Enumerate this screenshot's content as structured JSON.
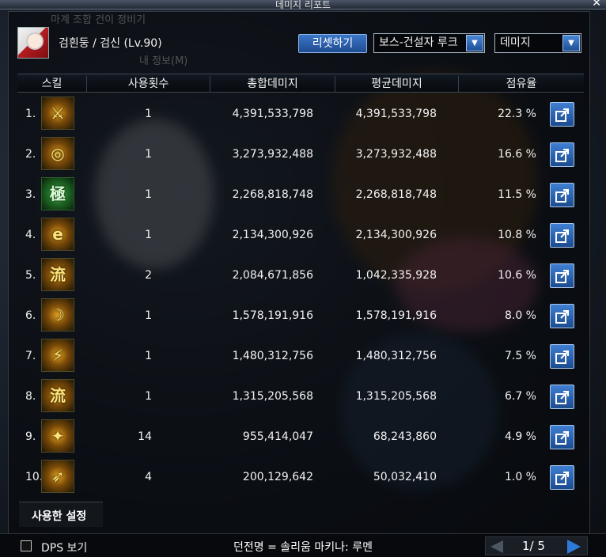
{
  "window": {
    "title": "데미지 리포트",
    "close_icon": "✕"
  },
  "header": {
    "character": "검흰둥 / 검신 (Lv.90)",
    "reset_label": "리셋하기",
    "dungeon_filter": "보스-건설자 루크",
    "metric_filter": "데미지",
    "ghost_title": "마계 조합 건이 정비기",
    "ghost_sub": "내 정보(M)"
  },
  "table": {
    "headers": [
      "스킬",
      "사용횟수",
      "총합데미지",
      "평균데미지",
      "점유율"
    ],
    "rows": [
      {
        "rank": "1.",
        "icon": "slash-skill-icon",
        "glyph": "⚔",
        "count": "1",
        "total": "4,391,533,798",
        "avg": "4,391,533,798",
        "share": "22.3 %"
      },
      {
        "rank": "2.",
        "icon": "whirl-skill-icon",
        "glyph": "◎",
        "count": "1",
        "total": "3,273,932,488",
        "avg": "3,273,932,488",
        "share": "16.6 %"
      },
      {
        "rank": "3.",
        "icon": "kanji-skill-icon",
        "glyph": "極",
        "count": "1",
        "total": "2,268,818,748",
        "avg": "2,268,818,748",
        "share": "11.5 %"
      },
      {
        "rank": "4.",
        "icon": "spiral-skill-icon",
        "glyph": "e",
        "count": "1",
        "total": "2,134,300,926",
        "avg": "2,134,300,926",
        "share": "10.8 %"
      },
      {
        "rank": "5.",
        "icon": "flow-skill-icon",
        "glyph": "流",
        "count": "2",
        "total": "2,084,671,856",
        "avg": "1,042,335,928",
        "share": "10.6 %"
      },
      {
        "rank": "6.",
        "icon": "arc-skill-icon",
        "glyph": "☽",
        "count": "1",
        "total": "1,578,191,916",
        "avg": "1,578,191,916",
        "share": "8.0 %"
      },
      {
        "rank": "7.",
        "icon": "beast-skill-icon",
        "glyph": "⚡",
        "count": "1",
        "total": "1,480,312,756",
        "avg": "1,480,312,756",
        "share": "7.5 %"
      },
      {
        "rank": "8.",
        "icon": "lightning-flow-skill-icon",
        "glyph": "流",
        "count": "1",
        "total": "1,315,205,568",
        "avg": "1,315,205,568",
        "share": "6.7 %"
      },
      {
        "rank": "9.",
        "icon": "dash-skill-icon",
        "glyph": "✦",
        "count": "14",
        "total": "955,414,047",
        "avg": "68,243,860",
        "share": "4.9 %"
      },
      {
        "rank": "10.",
        "icon": "kick-skill-icon",
        "glyph": "➶",
        "count": "4",
        "total": "200,129,642",
        "avg": "50,032,410",
        "share": "1.0 %"
      }
    ]
  },
  "footer": {
    "settings_tab": "사용한 설정",
    "dps_label": "DPS 보기",
    "dungeon_name": "던전명 = 솔리움 마키나: 루멘",
    "page": "1/ 5"
  },
  "colors": {
    "accent": "#2f7ad8",
    "panel": "#06080b"
  }
}
